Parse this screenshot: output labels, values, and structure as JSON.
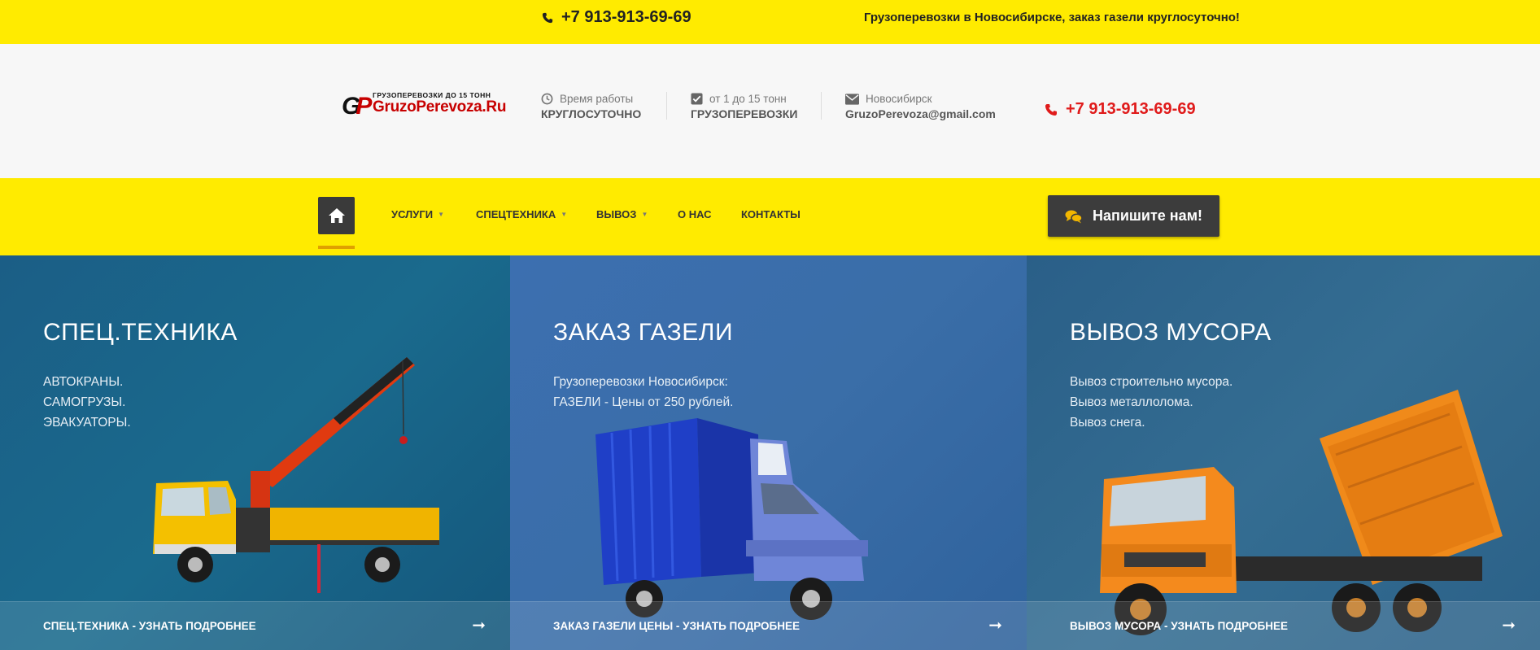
{
  "topbar": {
    "phone": "+7 913-913-69-69",
    "tagline": "Грузоперевозки в Новосибирске, заказ газели круглосуточно!"
  },
  "header": {
    "logo": {
      "mark": "GP",
      "small_text": "ГРУЗОПЕРЕВОЗКИ ДО 15 ТОНН",
      "big_text": "GruzoPerevoza.Ru"
    },
    "info": [
      {
        "icon": "clock-icon",
        "label": "Время работы",
        "value": "КРУГЛОСУТОЧНО"
      },
      {
        "icon": "checkbox-icon",
        "label": "от 1 до 15 тонн",
        "value": "ГРУЗОПЕРЕВОЗКИ"
      },
      {
        "icon": "envelope-icon",
        "label": "Новосибирск",
        "value": "GruzoPerevoza@gmail.com"
      }
    ],
    "phone": "+7 913-913-69-69"
  },
  "nav": {
    "items": [
      {
        "label": "УСЛУГИ",
        "dropdown": true
      },
      {
        "label": "СПЕЦТЕХНИКА",
        "dropdown": true
      },
      {
        "label": "ВЫВОЗ",
        "dropdown": true
      },
      {
        "label": "О НАС",
        "dropdown": false
      },
      {
        "label": "КОНТАКТЫ",
        "dropdown": false
      }
    ],
    "cta": "Напишите нам!"
  },
  "panels": [
    {
      "title": "СПЕЦ.ТЕХНИКА",
      "lines": [
        "АВТОКРАНЫ.",
        "САМОГРУЗЫ.",
        "ЭВАКУАТОРЫ."
      ],
      "link": "СПЕЦ.ТЕХНИКА - УЗНАТЬ ПОДРОБНЕЕ"
    },
    {
      "title": "ЗАКАЗ ГАЗЕЛИ",
      "lines": [
        "Грузоперевозки Новосибирск:",
        "ГАЗЕЛИ - Цены от 250 рублей."
      ],
      "link": "ЗАКАЗ ГАЗЕЛИ ЦЕНЫ - УЗНАТЬ ПОДРОБНЕЕ"
    },
    {
      "title": "ВЫВОЗ МУСОРА",
      "lines": [
        "Вывоз строительно мусора.",
        "Вывоз металлолома.",
        "Вывоз снега."
      ],
      "link": "ВЫВОЗ МУСОРА - УЗНАТЬ ПОДРОБНЕЕ"
    }
  ],
  "colors": {
    "yellow": "#ffeb00",
    "dark": "#3a3a3a",
    "red": "#e01b1b",
    "underline": "#e0a000"
  }
}
